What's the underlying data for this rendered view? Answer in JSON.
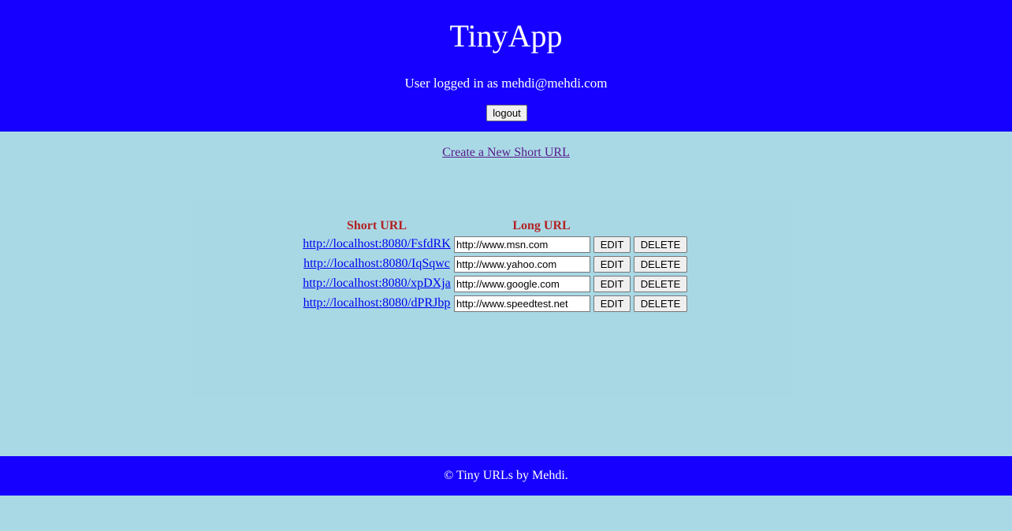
{
  "header": {
    "title": "TinyApp",
    "user_line": "User logged in as mehdi@mehdi.com",
    "logout_label": "logout"
  },
  "nav": {
    "create_link": "Create a New Short URL"
  },
  "table": {
    "headers": {
      "short": "Short URL",
      "long": "Long URL"
    },
    "rows": [
      {
        "short_url": "http://localhost:8080/FsfdRK",
        "long_url": "http://www.msn.com",
        "edit_label": "EDIT",
        "delete_label": "DELETE"
      },
      {
        "short_url": "http://localhost:8080/IqSqwc",
        "long_url": "http://www.yahoo.com",
        "edit_label": "EDIT",
        "delete_label": "DELETE"
      },
      {
        "short_url": "http://localhost:8080/xpDXja",
        "long_url": "http://www.google.com",
        "edit_label": "EDIT",
        "delete_label": "DELETE"
      },
      {
        "short_url": "http://localhost:8080/dPRJbp",
        "long_url": "http://www.speedtest.net",
        "edit_label": "EDIT",
        "delete_label": "DELETE"
      }
    ]
  },
  "footer": {
    "text": "© Tiny URLs by Mehdi."
  },
  "colors": {
    "header_bg": "#1600ff",
    "page_bg": "#aad9e6",
    "column_header": "#b22222",
    "link": "#0000ee",
    "visited_link": "#551a8b"
  }
}
